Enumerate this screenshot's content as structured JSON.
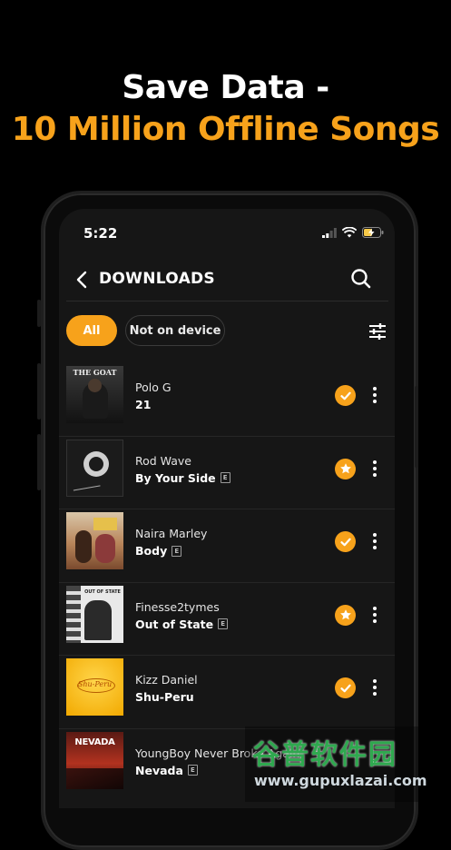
{
  "promo": {
    "line1": "Save Data -",
    "line2": "10 Million Offline Songs"
  },
  "status_bar": {
    "time": "5:22"
  },
  "header": {
    "title": "DOWNLOADS"
  },
  "filters": {
    "all": "All",
    "not_on_device": "Not on device"
  },
  "tracks": [
    {
      "artist": "Polo G",
      "title": "21",
      "explicit": false,
      "status_icon": "check-icon",
      "art_text": "THE GOAT"
    },
    {
      "artist": "Rod Wave",
      "title": "By Your Side",
      "explicit": true,
      "status_icon": "star-icon",
      "art_text": ""
    },
    {
      "artist": "Naira Marley",
      "title": "Body",
      "explicit": true,
      "status_icon": "check-icon",
      "art_text": ""
    },
    {
      "artist": "Finesse2tymes",
      "title": "Out of State",
      "explicit": true,
      "status_icon": "star-icon",
      "art_text": "OUT OF STATE"
    },
    {
      "artist": "Kizz Daniel",
      "title": "Shu-Peru",
      "explicit": false,
      "status_icon": "check-icon",
      "art_text": "Shu-Peru"
    },
    {
      "artist": "YoungBoy Never Broke Again",
      "title": "Nevada",
      "explicit": true,
      "status_icon": "check-icon",
      "art_text": "NEVADA"
    }
  ],
  "explicit_badge": "E",
  "watermark": {
    "line1": "谷普软件园",
    "line2": "www.gupuxlazai.com"
  },
  "colors": {
    "accent": "#f7a21b",
    "screen_bg": "#161616",
    "page_bg": "#000000"
  }
}
